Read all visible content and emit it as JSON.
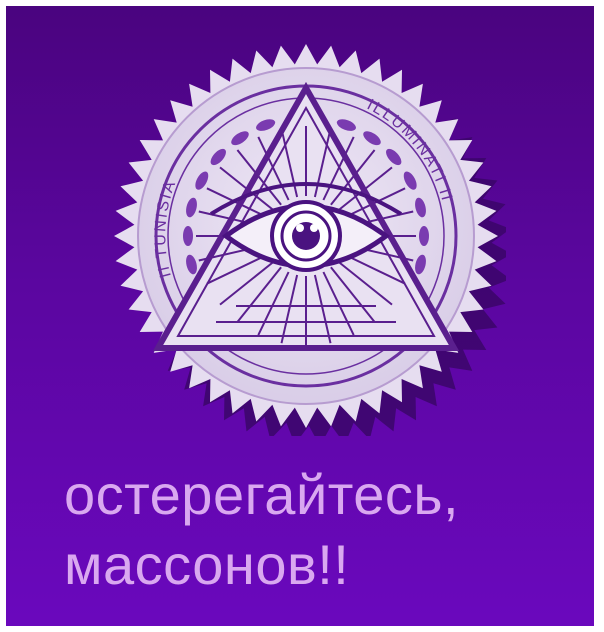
{
  "caption": {
    "line1": "остерегайтесь,",
    "line2": "массонов!!"
  },
  "seal": {
    "icon": "illuminati-seal-icon",
    "ring_text_left": "TUNISIA",
    "ring_text_right": "ILLUMINATI",
    "ring_text_small": "II"
  },
  "colors": {
    "background_top": "#4a047f",
    "background_bottom": "#6a08bd",
    "seal_face": "#e6ddf0",
    "seal_shadow": "#3b0668",
    "caption_text": "#d9a8f0"
  }
}
